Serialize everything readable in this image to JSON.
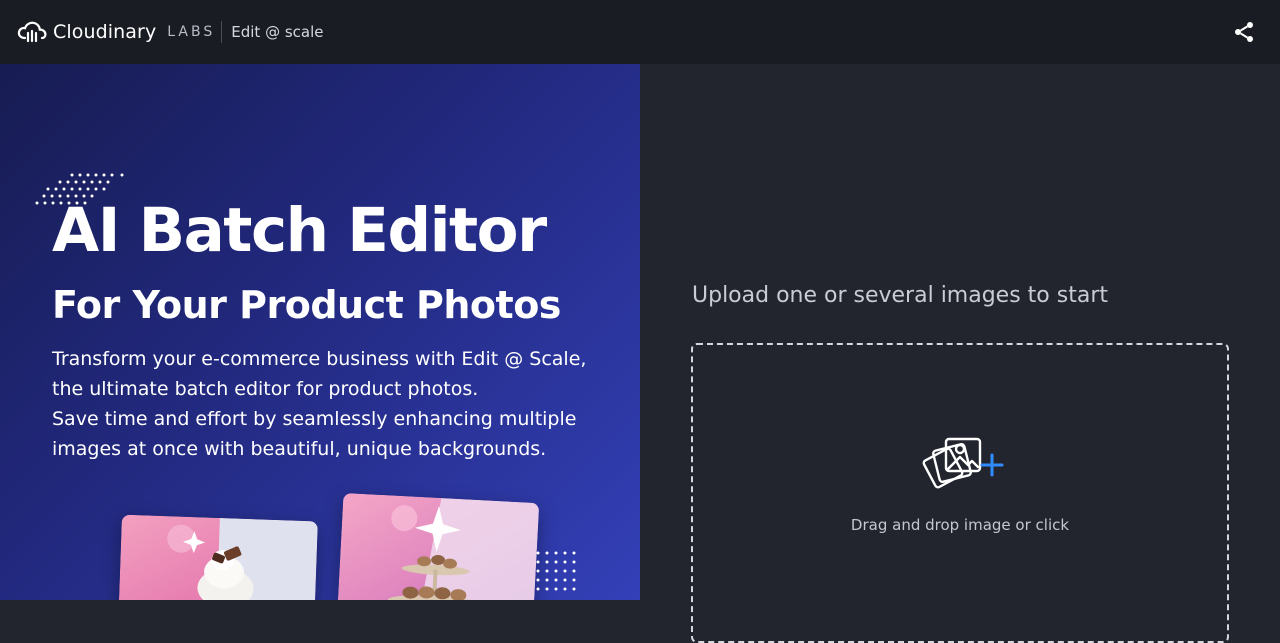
{
  "header": {
    "brand_name": "Cloudinary",
    "brand_suffix": "LABS",
    "product_name": "Edit @ scale",
    "share_icon": "share-icon"
  },
  "hero": {
    "title": "AI Batch Editor",
    "subtitle": "For Your Product Photos",
    "description_lines": [
      "Transform your e-commerce business with Edit @ Scale,",
      "the ultimate batch editor for product photos.",
      "Save time and effort by seamlessly enhancing multiple",
      "images at once with beautiful, unique backgrounds."
    ],
    "cards": [
      {
        "subject": "whipped cream dessert with chocolate",
        "icon": "product-photo-1"
      },
      {
        "subject": "macarons on a tiered stand",
        "icon": "product-photo-2"
      }
    ]
  },
  "upload": {
    "heading": "Upload one or several images to start",
    "dropzone_label": "Drag and drop image or click",
    "dropzone_icon": "add-images-icon"
  },
  "colors": {
    "header_bg": "#1a1c23",
    "panel_bg": "#22252e",
    "hero_gradient_start": "#171c52",
    "hero_gradient_end": "#3340b8",
    "accent_plus": "#2f8cff"
  }
}
